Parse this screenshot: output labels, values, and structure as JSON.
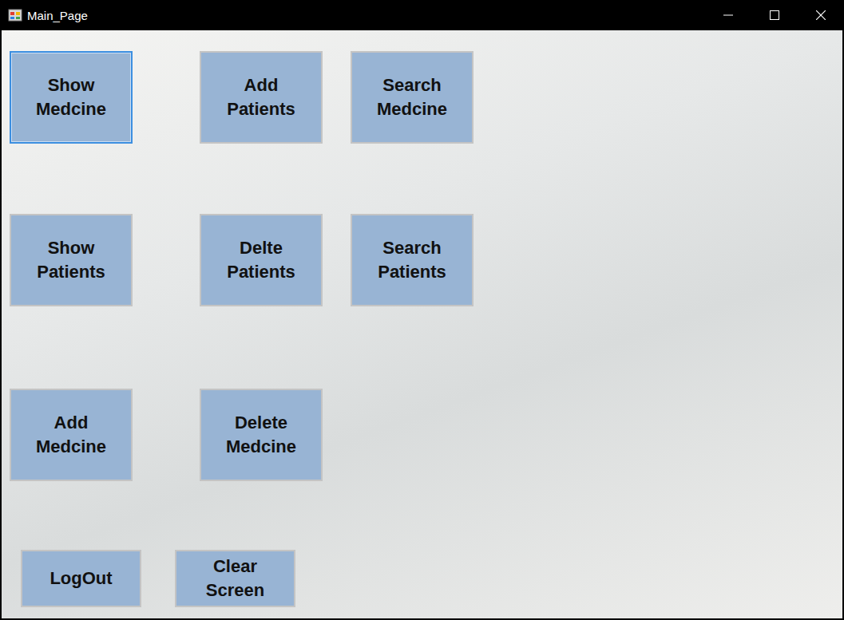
{
  "window": {
    "title": "Main_Page"
  },
  "button_rows": [
    [
      {
        "label": "Show Medcine",
        "focused": true
      },
      {
        "label": "Add Patients",
        "focused": false
      },
      {
        "label": "Search Medcine",
        "focused": false
      }
    ],
    [
      {
        "label": "Show Patients",
        "focused": false
      },
      {
        "label": "Delte Patients",
        "focused": false
      },
      {
        "label": "Search Patients",
        "focused": false
      }
    ],
    [
      {
        "label": "Add Medcine",
        "focused": false
      },
      {
        "label": "Delete Medcine",
        "focused": false
      }
    ]
  ],
  "bottom_buttons": [
    {
      "label": "LogOut",
      "focused": false
    },
    {
      "label": "Clear Screen",
      "focused": false
    }
  ]
}
